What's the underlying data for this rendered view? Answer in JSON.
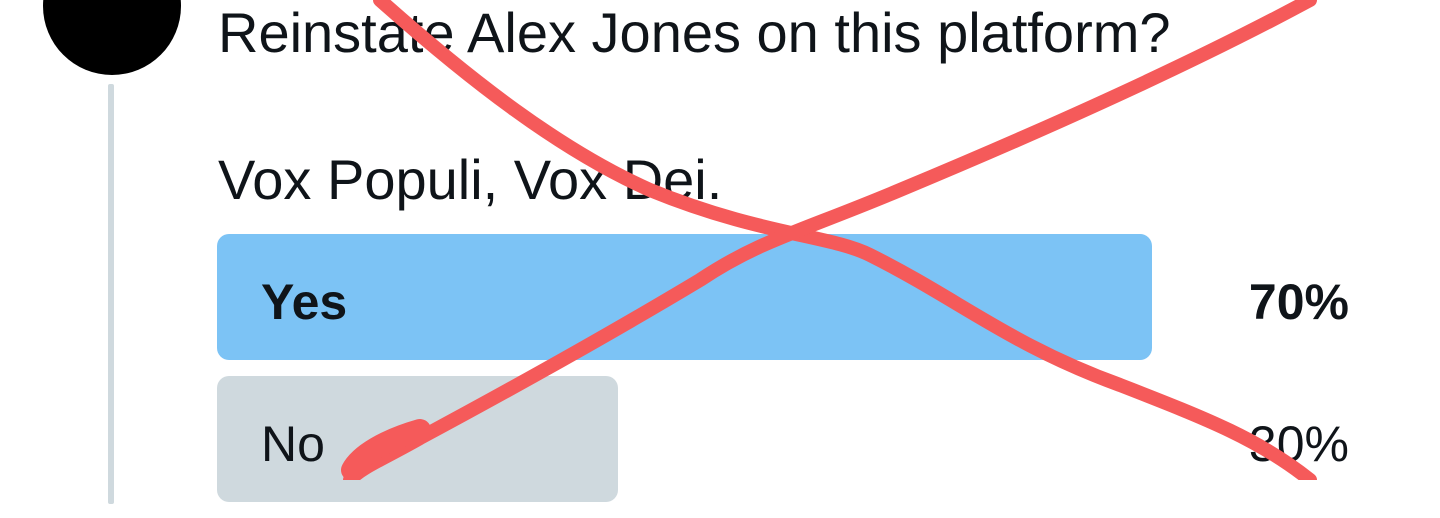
{
  "author": {
    "avatar_icon": "x-logo-icon",
    "avatar_background": "#000000"
  },
  "tweet": {
    "question": "Reinstate Alex Jones on this platform?",
    "subtitle": "Vox Populi, Vox Dei."
  },
  "poll": {
    "options": [
      {
        "label": "Yes",
        "percent_text": "70%",
        "share": 0.7,
        "winner": true,
        "bar_color": "#7cc3f5"
      },
      {
        "label": "No",
        "percent_text": "30%",
        "share": 0.3,
        "winner": false,
        "bar_color": "#cfd9de"
      }
    ]
  },
  "overlay": {
    "icon": "red-x-cross-out-icon",
    "color": "#f55a5a"
  },
  "colors": {
    "text": "#0f1419",
    "thread_line": "#cfd9de"
  }
}
